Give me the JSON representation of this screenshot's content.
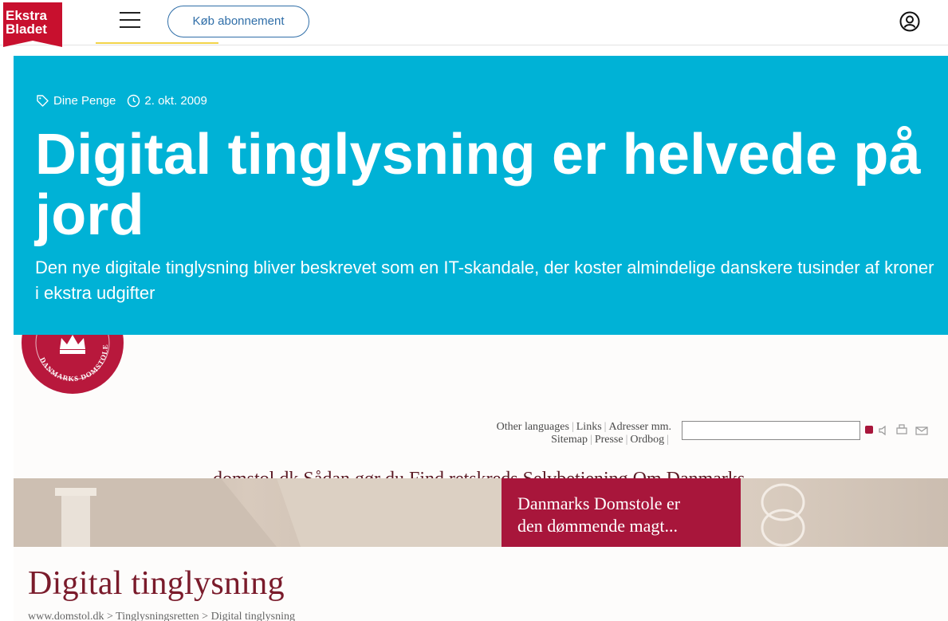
{
  "header": {
    "logo_line1": "Ekstra",
    "logo_line2": "Bladet",
    "subscribe_label": "Køb abonnement"
  },
  "article": {
    "category": "Dine Penge",
    "date": "2. okt. 2009",
    "headline_line1": "Digital tinglysning er helvede på",
    "headline_line2": "jord",
    "lede": "Den nye digitale tinglysning bliver beskrevet som en IT-skandale, der koster almindelige danskere tusinder af kroner i ekstra udgifter"
  },
  "figure": {
    "seal_text": "DANMARKS DOMSTOLE",
    "links": [
      "Other languages",
      "Links",
      "Adresser mm.",
      "Sitemap",
      "Presse",
      "Ordbog"
    ],
    "nav": "domstol.dk  Sådan gør du  Find retskreds  Selvbetjening  Om Danmarks",
    "banner_line1": "Danmarks Domstole er",
    "banner_line2": "den dømmende magt...",
    "page_heading": "Digital tinglysning",
    "breadcrumb": "www.domstol.dk > Tinglysningsretten > Digital tinglysning"
  },
  "colors": {
    "brand_red": "#c8102e",
    "hero_bg": "#00b2d6",
    "banner_red": "#a8163b",
    "subscribe_blue": "#2f6ea8"
  },
  "icons": [
    "menu-icon",
    "user-icon",
    "tag-icon",
    "clock-icon",
    "crown-icon",
    "speaker-icon",
    "print-icon",
    "mail-icon"
  ]
}
